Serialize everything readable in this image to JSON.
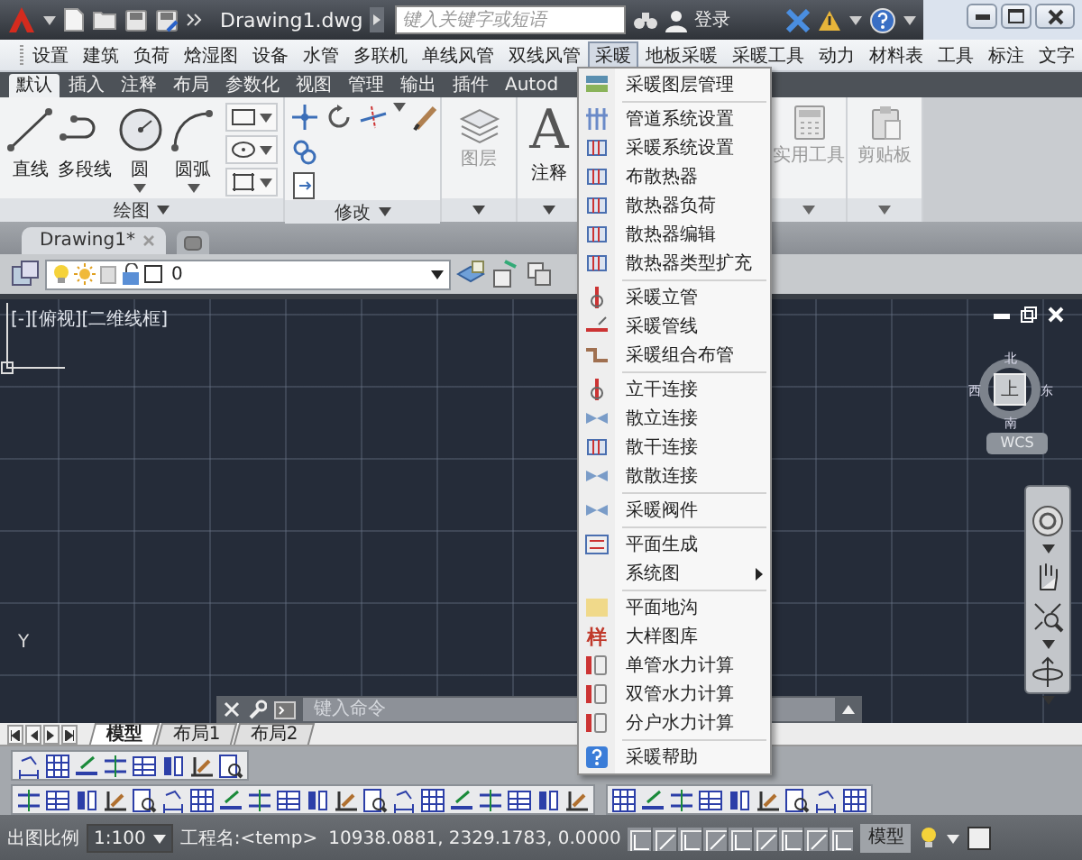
{
  "title_bar": {
    "filename": "Drawing1.dwg",
    "search": {
      "placeholder": "键入关键字或短语"
    },
    "sign_in": "登录"
  },
  "menu_bar": [
    {
      "label": "设置",
      "selected": false
    },
    {
      "label": "建筑",
      "selected": false
    },
    {
      "label": "负荷",
      "selected": false
    },
    {
      "label": "焓湿图",
      "selected": false
    },
    {
      "label": "设备",
      "selected": false
    },
    {
      "label": "水管",
      "selected": false
    },
    {
      "label": "多联机",
      "selected": false
    },
    {
      "label": "单线风管",
      "selected": false
    },
    {
      "label": "双线风管",
      "selected": false
    },
    {
      "label": "采暖",
      "selected": true
    },
    {
      "label": "地板采暖",
      "selected": false
    },
    {
      "label": "采暖工具",
      "selected": false
    },
    {
      "label": "动力",
      "selected": false
    },
    {
      "label": "材料表",
      "selected": false
    },
    {
      "label": "工具",
      "selected": false
    },
    {
      "label": "标注",
      "selected": false
    },
    {
      "label": "文字",
      "selected": false
    }
  ],
  "ribbon_tabs": [
    {
      "label": "默认",
      "selected": true
    },
    {
      "label": "插入",
      "selected": false
    },
    {
      "label": "注释",
      "selected": false
    },
    {
      "label": "布局",
      "selected": false
    },
    {
      "label": "参数化",
      "selected": false
    },
    {
      "label": "视图",
      "selected": false
    },
    {
      "label": "管理",
      "selected": false
    },
    {
      "label": "输出",
      "selected": false
    },
    {
      "label": "插件",
      "selected": false
    },
    {
      "label": "Autod",
      "selected": false
    }
  ],
  "ribbon": {
    "draw_tools": [
      {
        "label": "直线",
        "kind": "line",
        "dropdown": false
      },
      {
        "label": "多段线",
        "kind": "polyline",
        "dropdown": false
      },
      {
        "label": "圆",
        "kind": "circle",
        "dropdown": true
      },
      {
        "label": "圆弧",
        "kind": "arc",
        "dropdown": true
      }
    ],
    "draw_panel": "绘图",
    "modify_panel": "修改",
    "layer_panel": "图层",
    "annotate": {
      "glyph": "A",
      "label": "注释"
    },
    "utilities": "实用工具",
    "clipboard": "剪贴板"
  },
  "file_tab": "Drawing1*",
  "layer": "0",
  "viewport_label": "[-][俯视][二维线框]",
  "viewcube": {
    "face": "上",
    "north": "北",
    "south": "南",
    "east": "东",
    "west": "西",
    "wcs": "WCS"
  },
  "ucs_label": "Y",
  "command_line": {
    "placeholder": "键入命令"
  },
  "layout_tabs": [
    {
      "label": "模型",
      "selected": true
    },
    {
      "label": "布局1",
      "selected": false
    },
    {
      "label": "布局2",
      "selected": false
    }
  ],
  "status_bar": {
    "scale_label": "出图比例",
    "scale": "1:100",
    "project": "工程名:<temp>",
    "coordinates": "10938.0881, 2329.1783, 0.0000",
    "space": "模型"
  },
  "dropdown_menu": {
    "groups": [
      [
        {
          "label": "采暖图层管理",
          "kind": "command"
        }
      ],
      [
        {
          "label": "管道系统设置",
          "kind": "command"
        },
        {
          "label": "采暖系统设置",
          "kind": "command"
        },
        {
          "label": "布散热器",
          "kind": "command"
        },
        {
          "label": "散热器负荷",
          "kind": "command"
        },
        {
          "label": "散热器编辑",
          "kind": "command"
        },
        {
          "label": "散热器类型扩充",
          "kind": "command"
        }
      ],
      [
        {
          "label": "采暖立管",
          "kind": "command"
        },
        {
          "label": "采暖管线",
          "kind": "command"
        },
        {
          "label": "采暖组合布管",
          "kind": "command"
        }
      ],
      [
        {
          "label": "立干连接",
          "kind": "command"
        },
        {
          "label": "散立连接",
          "kind": "command"
        },
        {
          "label": "散干连接",
          "kind": "command"
        },
        {
          "label": "散散连接",
          "kind": "command"
        }
      ],
      [
        {
          "label": "采暖阀件",
          "kind": "command"
        }
      ],
      [
        {
          "label": "平面生成",
          "kind": "command"
        },
        {
          "label": "系统图",
          "kind": "submenu"
        }
      ],
      [
        {
          "label": "平面地沟",
          "kind": "command"
        },
        {
          "label": "大样图库",
          "kind": "glyph",
          "glyph": "样"
        },
        {
          "label": "单管水力计算",
          "kind": "command"
        },
        {
          "label": "双管水力计算",
          "kind": "command"
        },
        {
          "label": "分户水力计算",
          "kind": "command"
        }
      ],
      [
        {
          "label": "采暖帮助",
          "kind": "command"
        }
      ]
    ]
  }
}
